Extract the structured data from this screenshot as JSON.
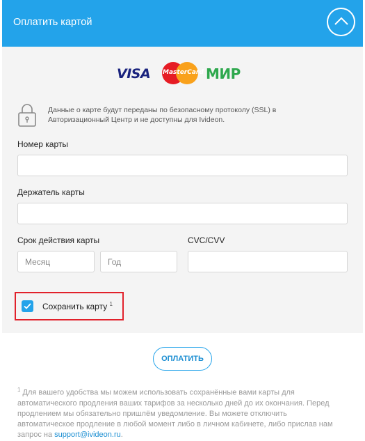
{
  "header": {
    "title": "Оплатить картой",
    "toggle_icon": "chevron-up-icon",
    "bg_color": "#23a3ea"
  },
  "logos": {
    "visa": "VISA",
    "mastercard": "MasterCard",
    "mir": "МИР"
  },
  "security": {
    "icon": "lock-icon",
    "text": "Данные о карте будут переданы по безопасному протоколу (SSL) в Авторизационный Центр и не доступны для Ivideon."
  },
  "form": {
    "card_number_label": "Номер карты",
    "card_number_value": "",
    "holder_label": "Держатель карты",
    "holder_value": "",
    "expiry_label": "Срок действия карты",
    "month_placeholder": "Месяц",
    "year_placeholder": "Год",
    "cvc_label": "CVC/CVV",
    "cvc_value": "",
    "save_card_label": "Сохранить карту",
    "save_card_sup": "1",
    "save_card_checked": true
  },
  "pay_button": "ОПЛАТИТЬ",
  "footnote": {
    "sup": "1",
    "text": " Для вашего удобства мы можем использовать сохранённые вами карты для автоматического продления ваших тарифов за несколько дней до их окончания. Перед продлением мы обязательно пришлём уведомление. Вы можете отключить автоматическое продление в любой момент либо в личном кабинете, либо прислав нам запрос на ",
    "link": "support@ivideon.ru",
    "end": "."
  },
  "colors": {
    "accent": "#23a3ea",
    "highlight_border": "#e1212b",
    "panel_bg": "#f4f4f4"
  }
}
